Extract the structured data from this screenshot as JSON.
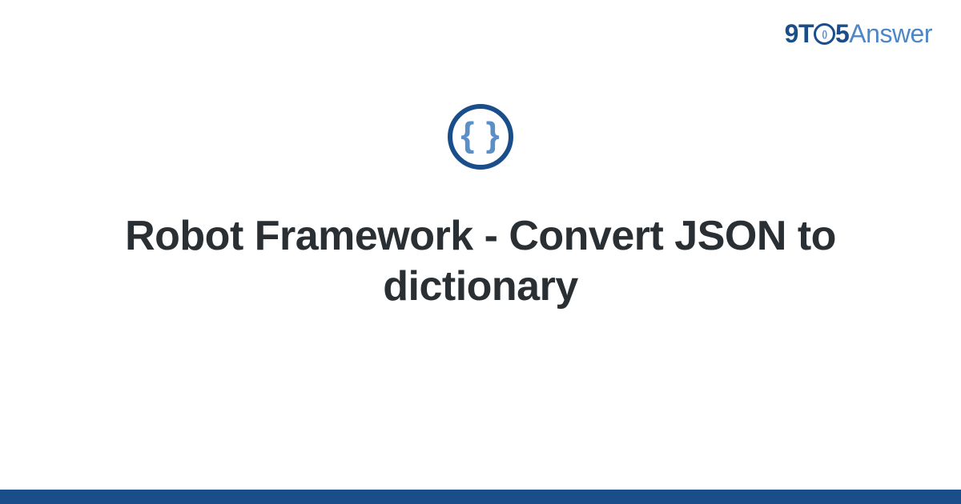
{
  "logo": {
    "part1": "9T",
    "inner": "()",
    "part2": "5",
    "part3": "Answer"
  },
  "tag_glyph": "{ }",
  "title": "Robot Framework - Convert JSON to dictionary"
}
